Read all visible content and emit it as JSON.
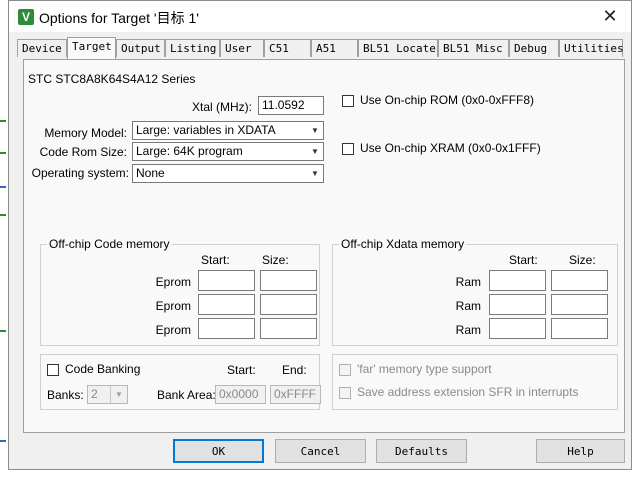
{
  "window": {
    "title": "Options for Target '目标 1'",
    "app_icon": "keil-uvision-icon"
  },
  "tabs": [
    {
      "label": "Device"
    },
    {
      "label": "Target"
    },
    {
      "label": "Output"
    },
    {
      "label": "Listing"
    },
    {
      "label": "User"
    },
    {
      "label": "C51"
    },
    {
      "label": "A51"
    },
    {
      "label": "BL51 Locate"
    },
    {
      "label": "BL51 Misc"
    },
    {
      "label": "Debug"
    },
    {
      "label": "Utilities"
    }
  ],
  "active_tab": "Target",
  "target": {
    "device_name": "STC STC8A8K64S4A12 Series",
    "xtal_label": "Xtal (MHz):",
    "xtal_value": "11.0592",
    "use_onchip_rom": "Use On-chip ROM (0x0-0xFFF8)",
    "use_onchip_xram": "Use On-chip XRAM (0x0-0x1FFF)",
    "memory_model_label": "Memory Model:",
    "memory_model_value": "Large: variables in XDATA",
    "code_rom_size_label": "Code Rom Size:",
    "code_rom_size_value": "Large: 64K program",
    "os_label": "Operating system:",
    "os_value": "None"
  },
  "offchip_code": {
    "title": "Off-chip Code memory",
    "start_header": "Start:",
    "size_header": "Size:",
    "rows": [
      {
        "label": "Eprom"
      },
      {
        "label": "Eprom"
      },
      {
        "label": "Eprom"
      }
    ]
  },
  "offchip_xdata": {
    "title": "Off-chip Xdata memory",
    "start_header": "Start:",
    "size_header": "Size:",
    "rows": [
      {
        "label": "Ram"
      },
      {
        "label": "Ram"
      },
      {
        "label": "Ram"
      }
    ]
  },
  "banking": {
    "code_banking_label": "Code Banking",
    "start_header": "Start:",
    "end_header": "End:",
    "banks_label": "Banks:",
    "banks_value": "2",
    "bank_area_label": "Bank Area:",
    "bank_start": "0x0000",
    "bank_end": "0xFFFF"
  },
  "far_options": {
    "far_memory": "'far' memory type support",
    "save_ext_sfr": "Save address extension SFR in interrupts"
  },
  "buttons": {
    "ok": "OK",
    "cancel": "Cancel",
    "defaults": "Defaults",
    "help": "Help"
  },
  "colors": {
    "accent": "#0078d7",
    "dialog_bg": "#f0f0f0",
    "panel_bg": "#f9f9f9"
  }
}
